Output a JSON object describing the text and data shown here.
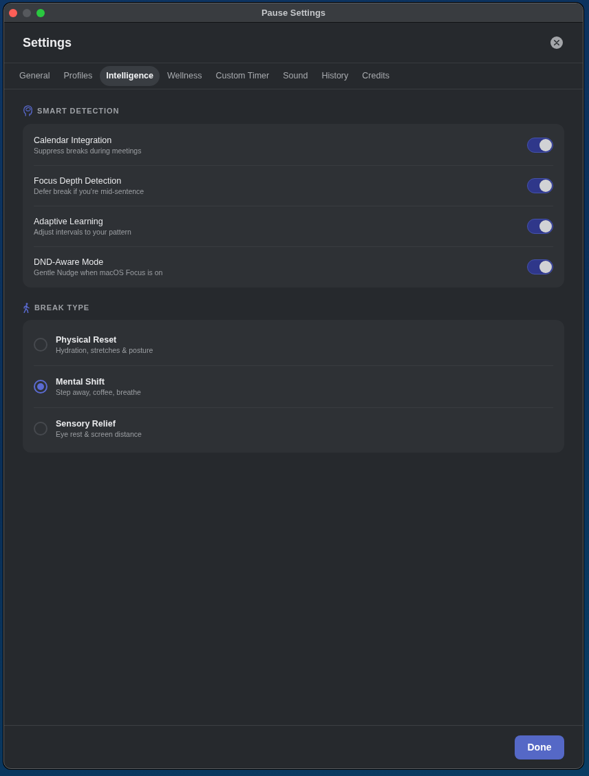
{
  "window": {
    "title": "Pause Settings"
  },
  "header": {
    "title": "Settings"
  },
  "tabs": [
    {
      "label": "General",
      "selected": false
    },
    {
      "label": "Profiles",
      "selected": false
    },
    {
      "label": "Intelligence",
      "selected": true
    },
    {
      "label": "Wellness",
      "selected": false
    },
    {
      "label": "Custom Timer",
      "selected": false
    },
    {
      "label": "Sound",
      "selected": false
    },
    {
      "label": "History",
      "selected": false
    },
    {
      "label": "Credits",
      "selected": false
    }
  ],
  "sections": [
    {
      "title": "SMART DETECTION",
      "kind": "toggles",
      "items": [
        {
          "label": "Calendar Integration",
          "description": "Suppress breaks during meetings",
          "on": true
        },
        {
          "label": "Focus Depth Detection",
          "description": "Defer break if you're mid-sentence",
          "on": true
        },
        {
          "label": "Adaptive Learning",
          "description": "Adjust intervals to your pattern",
          "on": true
        },
        {
          "label": "DND-Aware Mode",
          "description": "Gentle Nudge when macOS Focus is on",
          "on": true
        }
      ]
    },
    {
      "title": "BREAK TYPE",
      "kind": "radios",
      "items": [
        {
          "label": "Physical Reset",
          "description": "Hydration, stretches & posture",
          "selected": false
        },
        {
          "label": "Mental Shift",
          "description": "Step away, coffee, breathe",
          "selected": true
        },
        {
          "label": "Sensory Relief",
          "description": "Eye rest & screen distance",
          "selected": false
        }
      ]
    }
  ],
  "buttons": [
    "Done"
  ]
}
